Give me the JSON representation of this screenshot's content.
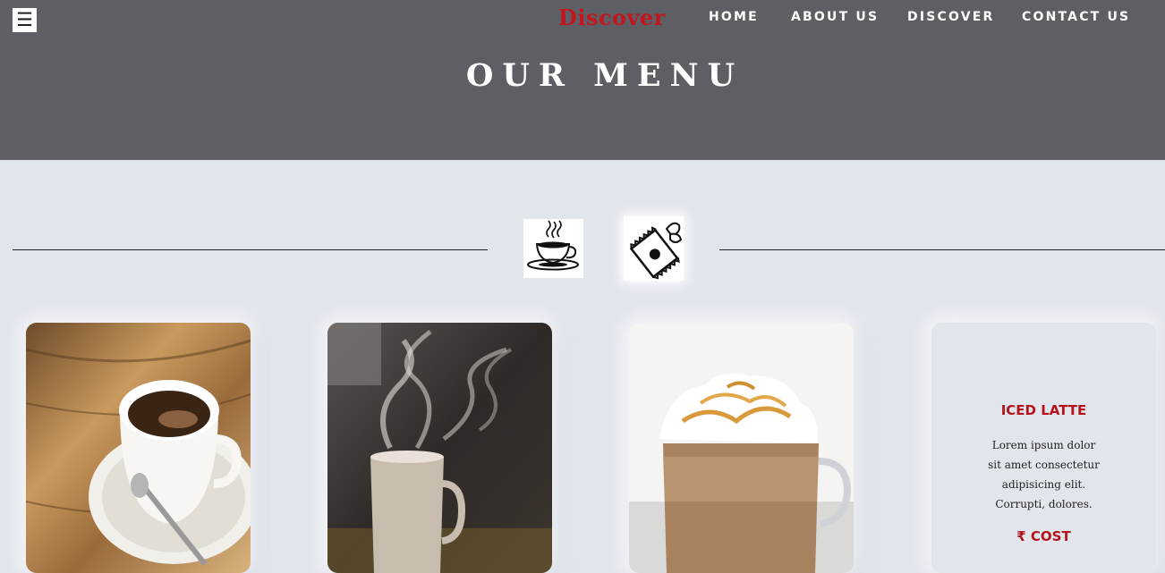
{
  "header": {
    "menu_icon": "hamburger-icon",
    "menu_glyph": "☰",
    "brand": "Discover",
    "nav": [
      "HOME",
      "ABOUT US",
      "DISCOVER",
      "CONTACT US"
    ],
    "title": "OUR MENU"
  },
  "categories": [
    {
      "icon": "coffee-cup-icon"
    },
    {
      "icon": "snack-bag-icon"
    }
  ],
  "cards": [
    {
      "image": "espresso-cup-photo"
    },
    {
      "image": "steaming-mug-photo"
    },
    {
      "image": "caramel-latte-photo"
    },
    {
      "title": "ICED LATTE",
      "description": "Lorem ipsum dolor sit amet consectetur adipisicing elit. Corrupti, dolores.",
      "cost": "₹ COST"
    }
  ],
  "colors": {
    "header_bg": "#5d5f64",
    "page_bg": "#e1e5ec",
    "brand": "#c2161e",
    "accent": "#b5121b"
  }
}
